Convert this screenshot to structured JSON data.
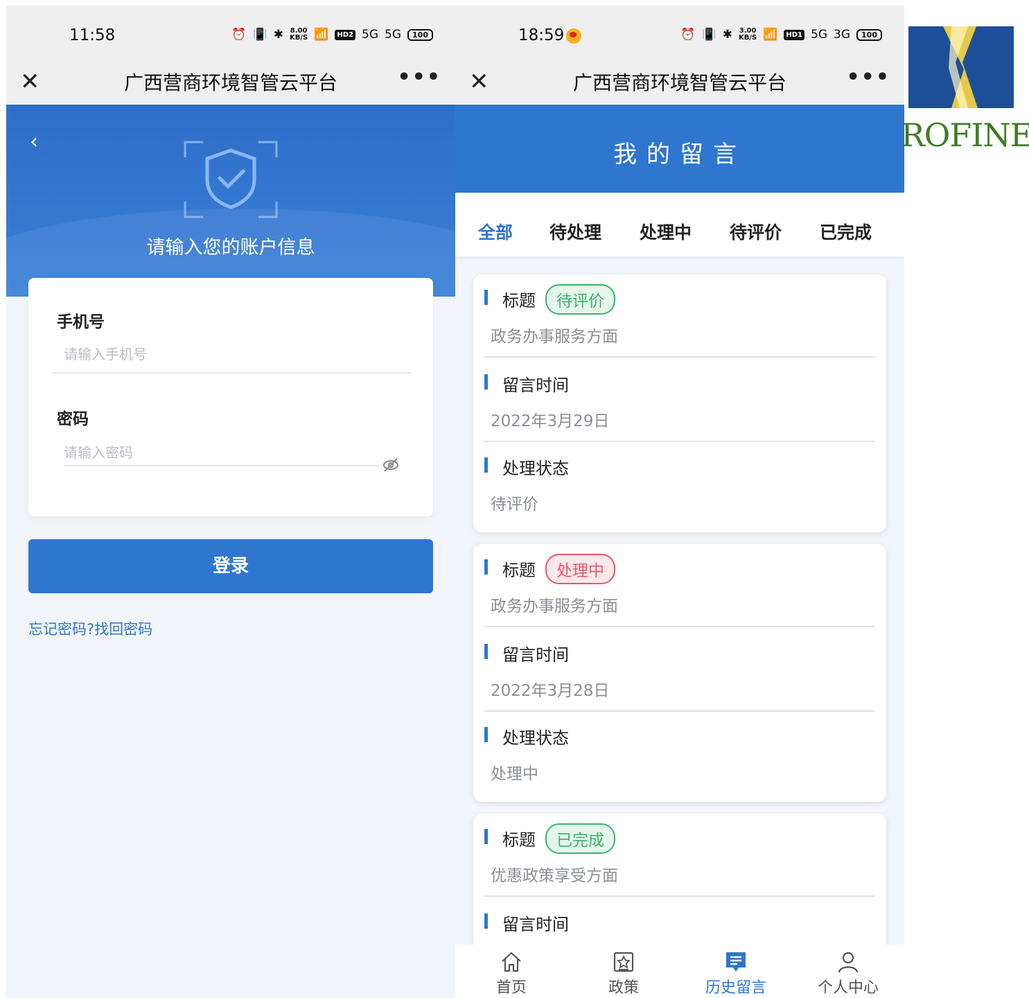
{
  "login_screen": {
    "status_bar": {
      "time": "11:58",
      "speed": "8.00\nKB/S",
      "hd": "HD2",
      "signal1": "5G",
      "signal2": "5G",
      "battery": "100"
    },
    "title_bar": {
      "close": "✕",
      "title": "广西营商环境智管云平台",
      "more": "•••"
    },
    "hero": {
      "back": "‹",
      "prompt": "请输入您的账户信息"
    },
    "form": {
      "phone_label": "手机号",
      "phone_placeholder": "请输入手机号",
      "password_label": "密码",
      "password_placeholder": "请输入密码"
    },
    "login_button": "登录",
    "forgot_link": "忘记密码?找回密码"
  },
  "messages_screen": {
    "status_bar": {
      "time": "18:59",
      "speed": "3.00\nKB/S",
      "hd": "HD1",
      "signal1": "5G",
      "signal2": "3G",
      "battery": "100"
    },
    "title_bar": {
      "close": "✕",
      "title": "广西营商环境智管云平台",
      "more": "•••"
    },
    "page_title": "我的留言",
    "tabs": [
      {
        "label": "全部",
        "active": true
      },
      {
        "label": "待处理",
        "active": false
      },
      {
        "label": "处理中",
        "active": false
      },
      {
        "label": "待评价",
        "active": false
      },
      {
        "label": "已完成",
        "active": false
      }
    ],
    "cards": [
      {
        "title_label": "标题",
        "badge": "待评价",
        "badge_color": "#3bb56b",
        "badge_bg": "#e6f6ec",
        "title_value": "政务办事服务方面",
        "time_label": "留言时间",
        "time_value": "2022年3月29日",
        "status_label": "处理状态",
        "status_value": "待评价"
      },
      {
        "title_label": "标题",
        "badge": "处理中",
        "badge_color": "#e8576a",
        "badge_bg": "#fde8eb",
        "title_value": "政务办事服务方面",
        "time_label": "留言时间",
        "time_value": "2022年3月28日",
        "status_label": "处理状态",
        "status_value": "处理中"
      },
      {
        "title_label": "标题",
        "badge": "已完成",
        "badge_color": "#3bb56b",
        "badge_bg": "#e6f6ec",
        "title_value": "优惠政策享受方面",
        "time_label": "留言时间"
      }
    ],
    "bottom_nav": [
      {
        "label": "首页",
        "icon": "home-icon",
        "active": false
      },
      {
        "label": "政策",
        "icon": "policy-icon",
        "active": false
      },
      {
        "label": "历史留言",
        "icon": "message-icon",
        "active": true
      },
      {
        "label": "个人中心",
        "icon": "user-icon",
        "active": false
      }
    ]
  },
  "logo": {
    "text": "ROFINE",
    "colors": {
      "blue": "#1c4f97",
      "gold": "#e6c84a",
      "green": "#3f7d28"
    }
  },
  "colors": {
    "primary": "#2f76cf",
    "background": "#f2f5f9"
  }
}
